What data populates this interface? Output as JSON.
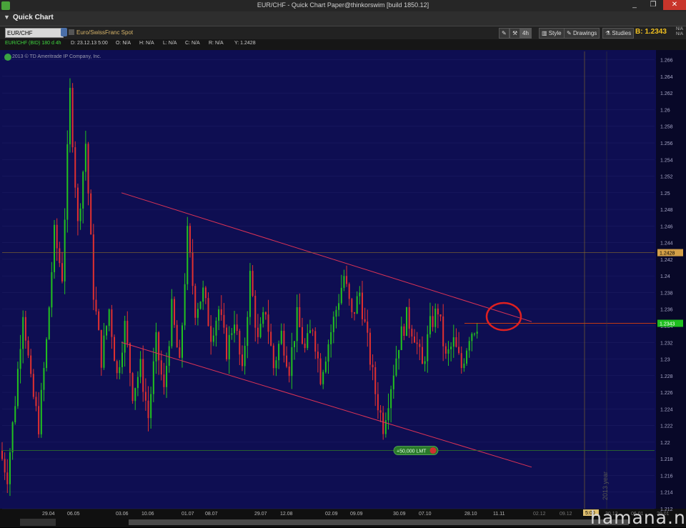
{
  "window": {
    "title": "EUR/CHF - Quick Chart Paper@thinkorswim [build 1850.12]",
    "min_glyph": "_",
    "max_glyph": "❐",
    "close_glyph": "✕"
  },
  "header": {
    "title": "Quick Chart"
  },
  "toolbar": {
    "symbol_value": "EUR/CHF",
    "symbol_description": "Euro/SwissFranc Spot",
    "aggregation": "4h",
    "style_label": "Style",
    "drawings_label": "Drawings",
    "studies_label": "Studies",
    "last_price": "B: 1.2343",
    "na_top": "N/A",
    "na_bottom": "N/A"
  },
  "infobar": {
    "symbol": "EUR/CHF (BID) 180 d 4h",
    "date": "D: 23.12.13 5:00",
    "open": "O: N/A",
    "high": "H: N/A",
    "low": "L: N/A",
    "close": "C: N/A",
    "range": "R: N/A",
    "y": "Y: 1.2428"
  },
  "copyright": "2013 © TD Ameritrade IP Company, Inc.",
  "order_label": "+50,000 LMT",
  "year_label": "2013 year",
  "crosshair_time": "5:00",
  "watermark": "hamana.net",
  "colors": {
    "background": "#0e0e52",
    "grid": "#1f1f66",
    "up_candle": "#22c21f",
    "down_candle": "#e03030",
    "trendline": "#dd3355",
    "price_line": "#ff4a00",
    "order_line": "#2b6b2b"
  },
  "chart_data": {
    "type": "candlestick",
    "title": "EUR/CHF (BID) 180 d 4h",
    "ylim": [
      1.212,
      1.267
    ],
    "y_ticks": [
      "1.266",
      "1.264",
      "1.262",
      "1.26",
      "1.258",
      "1.256",
      "1.254",
      "1.252",
      "1.25",
      "1.248",
      "1.246",
      "1.244",
      "1.242",
      "1.24",
      "1.238",
      "1.236",
      "1.234",
      "1.232",
      "1.23",
      "1.228",
      "1.226",
      "1.224",
      "1.222",
      "1.22",
      "1.218",
      "1.216",
      "1.214",
      "1.212"
    ],
    "x_ticks": [
      "29.04",
      "06.05",
      "03.06",
      "10.06",
      "01.07",
      "08.07",
      "29.07",
      "12.08",
      "02.09",
      "09.09",
      "30.09",
      "07.10",
      "28.10",
      "11.11",
      "02.12",
      "09.12",
      "5:00",
      "30.12",
      "06.01",
      "20.01"
    ],
    "current_price": "1.2343",
    "crosshair_price": "1.2428",
    "order_price": 1.219,
    "trend_points": [
      {
        "t": 0,
        "p": 1.219
      },
      {
        "t": 3,
        "p": 1.216
      },
      {
        "t": 6,
        "p": 1.225
      },
      {
        "t": 9,
        "p": 1.236
      },
      {
        "t": 12,
        "p": 1.227
      },
      {
        "t": 14,
        "p": 1.222
      },
      {
        "t": 17,
        "p": 1.232
      },
      {
        "t": 20,
        "p": 1.245
      },
      {
        "t": 23,
        "p": 1.24
      },
      {
        "t": 26,
        "p": 1.262
      },
      {
        "t": 28,
        "p": 1.246
      },
      {
        "t": 31,
        "p": 1.256
      },
      {
        "t": 34,
        "p": 1.238
      },
      {
        "t": 38,
        "p": 1.23
      },
      {
        "t": 42,
        "p": 1.236
      },
      {
        "t": 45,
        "p": 1.228
      },
      {
        "t": 48,
        "p": 1.234
      },
      {
        "t": 51,
        "p": 1.226
      },
      {
        "t": 54,
        "p": 1.229
      },
      {
        "t": 57,
        "p": 1.223
      },
      {
        "t": 61,
        "p": 1.232
      },
      {
        "t": 64,
        "p": 1.226
      },
      {
        "t": 67,
        "p": 1.236
      },
      {
        "t": 70,
        "p": 1.229
      },
      {
        "t": 73,
        "p": 1.245
      },
      {
        "t": 76,
        "p": 1.236
      },
      {
        "t": 79,
        "p": 1.238
      },
      {
        "t": 82,
        "p": 1.233
      },
      {
        "t": 85,
        "p": 1.236
      },
      {
        "t": 88,
        "p": 1.231
      },
      {
        "t": 91,
        "p": 1.235
      },
      {
        "t": 94,
        "p": 1.228
      },
      {
        "t": 97,
        "p": 1.24
      },
      {
        "t": 100,
        "p": 1.232
      },
      {
        "t": 103,
        "p": 1.236
      },
      {
        "t": 106,
        "p": 1.229
      },
      {
        "t": 109,
        "p": 1.233
      },
      {
        "t": 112,
        "p": 1.229
      },
      {
        "t": 115,
        "p": 1.235
      },
      {
        "t": 118,
        "p": 1.231
      },
      {
        "t": 121,
        "p": 1.234
      },
      {
        "t": 124,
        "p": 1.228
      },
      {
        "t": 127,
        "p": 1.232
      },
      {
        "t": 130,
        "p": 1.236
      },
      {
        "t": 133,
        "p": 1.24
      },
      {
        "t": 136,
        "p": 1.235
      },
      {
        "t": 139,
        "p": 1.238
      },
      {
        "t": 142,
        "p": 1.232
      },
      {
        "t": 145,
        "p": 1.226
      },
      {
        "t": 148,
        "p": 1.222
      },
      {
        "t": 151,
        "p": 1.227
      },
      {
        "t": 154,
        "p": 1.232
      },
      {
        "t": 157,
        "p": 1.235
      },
      {
        "t": 160,
        "p": 1.233
      },
      {
        "t": 163,
        "p": 1.229
      },
      {
        "t": 166,
        "p": 1.234
      },
      {
        "t": 169,
        "p": 1.236
      },
      {
        "t": 172,
        "p": 1.23
      },
      {
        "t": 175,
        "p": 1.232
      },
      {
        "t": 178,
        "p": 1.229
      },
      {
        "t": 181,
        "p": 1.233
      },
      {
        "t": 184,
        "p": 1.2343
      }
    ],
    "upper_trendline": [
      {
        "t": 42,
        "p": 1.25
      },
      {
        "t": 188,
        "p": 1.2345
      }
    ],
    "lower_trendline": [
      {
        "t": 42,
        "p": 1.232
      },
      {
        "t": 188,
        "p": 1.217
      }
    ]
  }
}
